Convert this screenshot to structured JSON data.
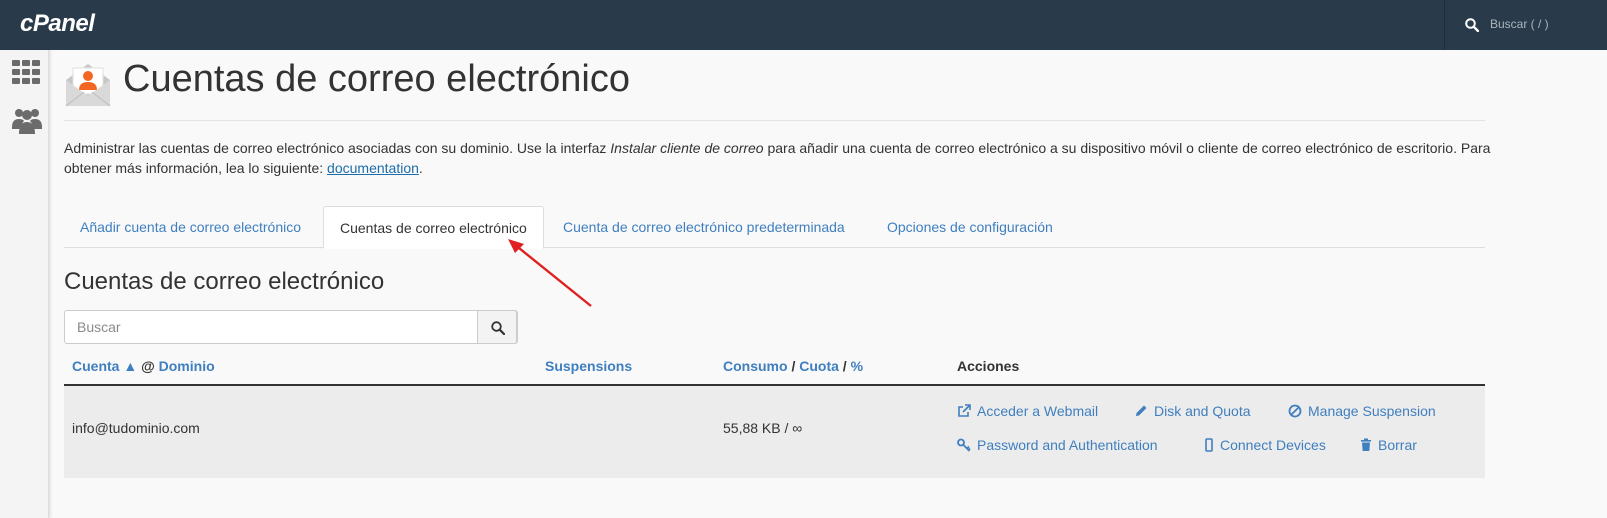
{
  "app": {
    "logo": "cPanel",
    "search_placeholder": "Buscar ( / )"
  },
  "page": {
    "title": "Cuentas de correo electrónico",
    "intro_part1": "Administrar las cuentas de correo electrónico asociadas con su dominio. Use la interfaz ",
    "intro_italic": "Instalar cliente de correo",
    "intro_part2": " para añadir una cuenta de correo electrónico a su dispositivo móvil o cliente de correo electrónico de escritorio. Para obtener más información, lea lo siguiente: ",
    "intro_link": "documentation",
    "intro_end": "."
  },
  "tabs": [
    {
      "label": "Añadir cuenta de correo electrónico",
      "active": false
    },
    {
      "label": "Cuentas de correo electrónico",
      "active": true
    },
    {
      "label": "Cuenta de correo electrónico predeterminada",
      "active": false
    },
    {
      "label": "Opciones de configuración",
      "active": false
    }
  ],
  "section": {
    "title": "Cuentas de correo electrónico",
    "search_placeholder": "Buscar"
  },
  "table": {
    "headers": {
      "account": "Cuenta",
      "sort_indicator": "▲",
      "at": "@",
      "domain": "Dominio",
      "suspensions": "Suspensions",
      "usage": "Consumo",
      "sep1": "/",
      "quota": "Cuota",
      "sep2": "/",
      "percent": "%",
      "actions": "Acciones"
    },
    "rows": [
      {
        "account": "info@tudominio.com",
        "usage": "55,88 KB / ∞",
        "actions": {
          "webmail": "Acceder a Webmail",
          "disk": "Disk and Quota",
          "suspension": "Manage Suspension",
          "password": "Password and Authentication",
          "devices": "Connect Devices",
          "delete": "Borrar"
        }
      }
    ]
  },
  "colors": {
    "topbar": "#293a4a",
    "link": "#3f7fbf",
    "annotation_arrow": "#e02020"
  }
}
